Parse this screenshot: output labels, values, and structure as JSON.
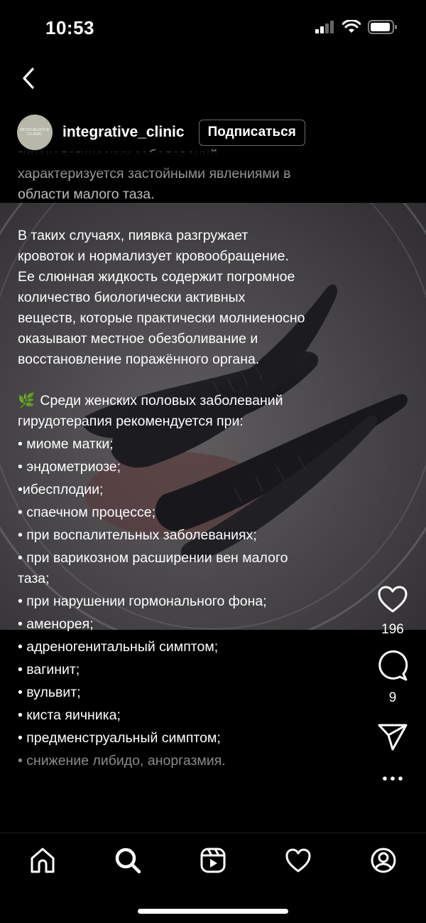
{
  "status": {
    "time": "10:53"
  },
  "post": {
    "username": "integrative_clinic",
    "follow_label": "Подписаться",
    "avatar_text_line1": "INTEGRATIVE",
    "avatar_text_line2": "CLINIC"
  },
  "caption": {
    "line_cut": "гинекологических заболеваний",
    "p1": "характеризуется застойными явлениями в\nобласти малого таза.",
    "p2": "В таких случаях, пиявка разгружает\nкровоток и нормализует кровообращение.\nЕе слюнная жидкость содержит погромное\nколичество биологически активных\nвеществ, которые практически молниеносно\nоказывают местное обезболивание и\nвосстановление поражённого органа.",
    "intro_icon": "🌿",
    "intro": " Среди женских половых заболеваний\nгирудотерапия рекомендуется при:",
    "items": [
      "• миоме матки;",
      "• эндометриозе;",
      "•ибесплодии;",
      "• спаечном процессе;",
      "• при воспалительных заболеваниях;",
      "• при варикозном расширении вен малого\nтаза;",
      "• при нарушении гормонального фона;",
      "• аменорея;",
      "• адреногенитальный симптом;",
      "• вагинит;",
      "• вульвит;",
      "• киста яичника;",
      "• предменструальный симптом;"
    ],
    "last_item": "• снижение либидо, аноргазмия."
  },
  "actions": {
    "likes": "196",
    "comments": "9"
  },
  "icons": {
    "back": "chevron-left-icon",
    "like": "heart-icon",
    "comment": "comment-bubble-icon",
    "share": "send-icon",
    "more": "more-dots-icon",
    "nav": [
      "home-icon",
      "search-icon",
      "reels-icon",
      "heart-icon",
      "profile-icon"
    ]
  },
  "colors": {
    "background": "#000000",
    "text": "#ffffff",
    "muted": "#8a8a8a"
  }
}
